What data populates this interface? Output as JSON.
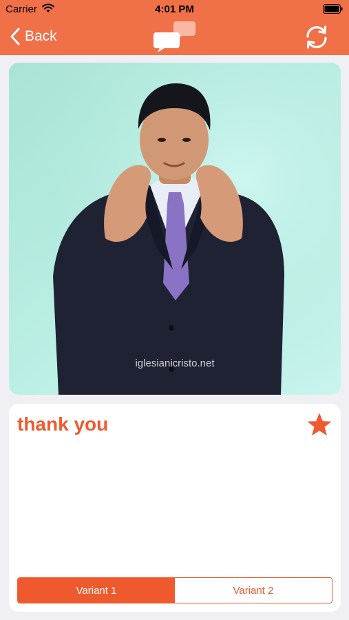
{
  "status_bar": {
    "carrier": "Carrier",
    "time": "4:01 PM"
  },
  "nav": {
    "back_label": "Back",
    "logo_icon": "chat-bubbles-icon",
    "refresh_icon": "refresh-icon"
  },
  "video": {
    "watermark": "iglesianicristo.net"
  },
  "word": {
    "title": "thank you",
    "favorite_icon": "star-icon"
  },
  "variants": {
    "items": [
      "Variant 1",
      "Variant 2"
    ],
    "selected": "Variant 1"
  },
  "colors": {
    "brand": "#f07048",
    "accent": "#ee5a2e",
    "background": "#efeff4"
  }
}
